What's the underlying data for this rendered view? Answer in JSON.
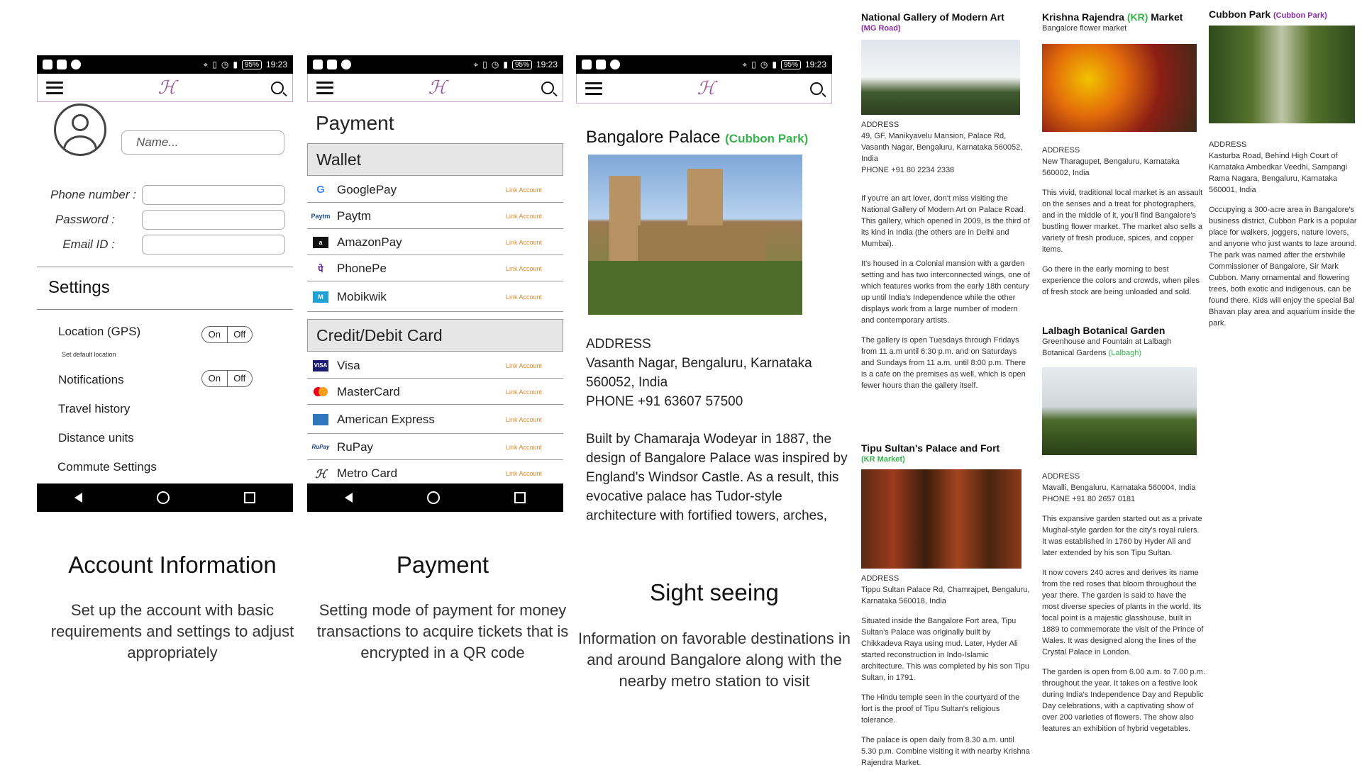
{
  "status": {
    "battery": "95%",
    "time": "19:23"
  },
  "logo_glyph": "ℋ",
  "account": {
    "name_placeholder": "Name...",
    "phone_label": "Phone number :",
    "password_label": "Password :",
    "email_label": "Email ID :",
    "settings_title": "Settings",
    "location_label": "Location (GPS)",
    "set_default": "Set default location",
    "notifications_label": "Notifications",
    "toggle_on": "On",
    "toggle_off": "Off",
    "travel_history": "Travel history",
    "distance_units": "Distance units",
    "commute_settings": "Commute Settings"
  },
  "payment": {
    "title": "Payment",
    "wallet_head": "Wallet",
    "card_head": "Credit/Debit Card",
    "link": "Link Account",
    "wallets": [
      "GooglePay",
      "Paytm",
      "AmazonPay",
      "PhonePe",
      "Mobikwik"
    ],
    "cards": [
      "Visa",
      "MasterCard",
      "American Express",
      "RuPay",
      "Metro Card"
    ]
  },
  "captions": {
    "account_title": "Account Information",
    "account_text": "Set up the account with basic requirements and settings to adjust appropriately",
    "payment_title": "Payment",
    "payment_text": "Setting mode of payment for money transactions to acquire tickets that is encrypted in a QR code",
    "sight_title": "Sight seeing",
    "sight_text": "Information on favorable destinations in and around Bangalore along with the nearby metro station to visit"
  },
  "palace": {
    "title": "Bangalore Palace",
    "metro": "(Cubbon Park)",
    "addr_label": "ADDRESS",
    "addr1": "Vasanth Nagar, Bengaluru, Karnataka",
    "addr2": "560052, India",
    "phone": "PHONE +91 63607 57500",
    "desc": "Built by Chamaraja Wodeyar in 1887, the design of Bangalore Palace was inspired by England's Windsor Castle. As a result, this evocative palace has Tudor-style architecture with fortified towers, arches,"
  },
  "ngma": {
    "title": "National Gallery of Modern Art",
    "metro": "(MG Road)",
    "addr": "ADDRESS",
    "addr_text": "49, GF, Manikyavelu Mansion, Palace Rd, Vasanth Nagar, Bengaluru, Karnataka 560052, India",
    "phone": "PHONE +91 80 2234 2338",
    "p1": "If you're an art lover, don't miss visiting the National Gallery of Modern Art on Palace Road. This gallery, which opened in 2009, is the third of its kind in India (the others are in Delhi and Mumbai).",
    "p2": "It's housed in a Colonial mansion with a garden setting and has two interconnected wings, one of which features works from the early 18th century up until India's Independence while the other displays work from a large number of modern and contemporary artists.",
    "p3": "The gallery is open Tuesdays through Fridays from 11 a.m until 6:30 p.m. and on Saturdays and Sundays from 11 a.m. until 8:00 p.m. There is a cafe on the premises as well, which is open fewer hours than the gallery itself."
  },
  "tipu": {
    "title": "Tipu Sultan's Palace and Fort",
    "metro": "(KR Market)",
    "addr": "ADDRESS",
    "addr_text": "Tippu Sultan Palace Rd, Chamrajpet, Bengaluru, Karnataka 560018, India",
    "p1": "Situated inside the Bangalore Fort area, Tipu Sultan's Palace was originally built by Chikkadeva Raya using mud. Later, Hyder Ali started reconstruction in Indo-Islamic architecture. This was completed by his son Tipu Sultan, in 1791.",
    "p2": "The Hindu temple seen in the courtyard of the fort is the proof of Tipu Sultan's religious tolerance.",
    "p3": "The palace is open daily from 8.30 a.m. until 5.30 p.m. Combine visiting it with nearby Krishna Rajendra Market."
  },
  "krm": {
    "title_a": "Krishna Rajendra ",
    "title_kr": "(KR)",
    "title_b": " Market",
    "subtitle": "Bangalore flower market",
    "addr": "ADDRESS",
    "addr_text": "New Tharagupet, Bengaluru, Karnataka 560002, India",
    "p1": "This vivid, traditional local market is an assault on the senses and a treat for photographers, and in the middle of it, you'll find Bangalore's bustling flower market. The market also sells a variety of fresh produce, spices, and copper items.",
    "p2": "Go there in the early morning to best experience the colors and crowds, when piles of fresh stock are being unloaded and sold."
  },
  "lalbagh": {
    "title": "Lalbagh Botanical Garden",
    "subtitle": "Greenhouse and Fountain at Lalbagh Botanical Gardens",
    "metro": "(Lalbagh)",
    "addr": "ADDRESS",
    "addr_text": "Mavalli, Bengaluru, Karnataka 560004, India",
    "phone": "PHONE +91 80 2657 0181",
    "p1": "This expansive garden started out as a private Mughal-style garden for the city's royal rulers. It was established in 1760 by Hyder Ali and later extended by his son Tipu Sultan.",
    "p2": "It now covers 240 acres and derives its name from the red roses that bloom throughout the year there. The garden is said to have the most diverse species of plants in the world. Its focal point is a majestic glasshouse, built in 1889 to commemorate the visit of the Prince of Wales. It was designed along the lines of the Crystal Palace in London.",
    "p3": "The garden is open from 6.00 a.m. to 7.00 p.m. throughout the year. It takes on a festive look during India's Independence Day and Republic Day celebrations, with a captivating show of over 200 varieties of flowers. The show also features an exhibition of hybrid vegetables."
  },
  "cubbon": {
    "title": "Cubbon Park",
    "metro": "(Cubbon Park)",
    "addr": "ADDRESS",
    "addr_text": "Kasturba Road, Behind High Court of Karnataka Ambedkar Veedhi, Sampangi Rama Nagara, Bengaluru, Karnataka 560001, India",
    "p1": "Occupying a 300-acre area in Bangalore's business district, Cubbon Park is a popular place for walkers, joggers, nature lovers, and anyone who just wants to laze around. The park was named after the erstwhile Commissioner of Bangalore, Sir Mark Cubbon. Many ornamental and flowering trees, both exotic and indigenous, can be found there. Kids will enjoy the special Bal Bhavan play area and aquarium inside the park."
  }
}
